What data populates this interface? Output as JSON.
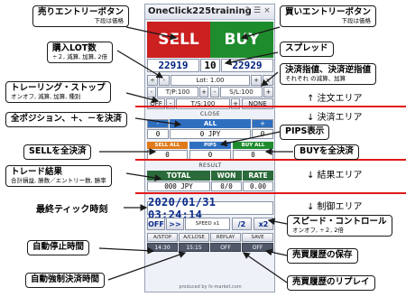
{
  "window": {
    "title": "OneClick225training",
    "icons": [
      "help-icon",
      "pin-icon",
      "close-icon"
    ],
    "help_glyph": "?",
    "pin_glyph": "☰",
    "close_glyph": "×"
  },
  "trade": {
    "sell_label": "SELL",
    "buy_label": "BUY",
    "sell_price": "22919",
    "spread": "10",
    "buy_price": "22929"
  },
  "lot": {
    "minus_label": "-",
    "value_label": "Lot: 1.00",
    "plus_label": "+",
    "half_label": "÷",
    "double_label": "x"
  },
  "tpsl": {
    "tp_label": "T/P:100",
    "sl_label": "S/L:100",
    "tp_minus": "-",
    "tp_plus": "+",
    "sl_minus": "-",
    "sl_plus": "+"
  },
  "trail": {
    "off_label": "OFF",
    "ts_label": "T/S:100",
    "minus": "-",
    "plus": "+",
    "none_label": "NONE"
  },
  "close": {
    "section_label": "CLOSE",
    "all_label": "ALL",
    "minus_label": "-",
    "plus_label": "+",
    "pos_left": "0",
    "pos_center": "0 JPY",
    "pos_right": "0",
    "sell_all_label": "SELL ALL",
    "pips_label": "PIPS",
    "buy_all_label": "BUY ALL",
    "sell_all_val": "0",
    "pips_val": "0",
    "buy_all_val": "0"
  },
  "result": {
    "section_label": "RESULT",
    "headers": [
      "TOTAL",
      "WON",
      "RATE"
    ],
    "values": [
      "000 JPY",
      "0/0",
      "0.00"
    ]
  },
  "control": {
    "clock": "2020/01/31 03:24:14",
    "off_label": "OFF",
    "ff_label": ">>",
    "speed_label": "SPEED x1",
    "half_label": "/2",
    "double_label": "x2",
    "autostop_label": "A/STOP",
    "aclose_label": "A/CLOSE",
    "replay_label": "REPLAY",
    "save_label": "SAVE",
    "autostop_time": "14:30",
    "aclose_time": "15:15",
    "replay_state": "OFF",
    "save_state": "OFF",
    "footer": "produced by fx-market.com"
  },
  "annotations": {
    "sell_entry": "売りエントリーボタン",
    "sell_entry_sub": "下段は価格",
    "buy_entry": "買いエントリーボタン",
    "buy_entry_sub": "下段は価格",
    "spread": "スプレッド",
    "lot": "購入LOT数",
    "lot_sub": "÷２, 減算, 加算, 2倍",
    "order_tpsl": "決済指値、決済逆指値",
    "order_tpsl_sub": "それぞれ の減算、加算",
    "trailing": "トレーリング・ストップ",
    "trailing_sub": "オンオフ, 減算, 加算, 種別",
    "order_area": "↑ 注文エリア",
    "all_close": "全ポジション、＋、－を決済",
    "close_area": "↓ 決済エリア",
    "pips_display": "PIPS表示",
    "sell_close": "SELLを全決済",
    "buy_close": "BUYを全決済",
    "result": "トレード結果",
    "result_sub": "合計損益, 勝数／エントリー数, 勝率",
    "result_area": "↓ 結果エリア",
    "last_tick": "最終ティック時刻",
    "control_area": "↓ 制御エリア",
    "speed_control": "スピード・コントロール",
    "speed_control_sub": "オンオフ, ÷２, 2倍",
    "auto_stop": "自動停止時間",
    "save_history": "売買履歴の保存",
    "auto_close": "自動強制決済時間",
    "replay": "売買履歴のリプレイ"
  },
  "colors": {
    "sell": "#cc1f1f",
    "buy": "#1e8c2d",
    "section_blue": "#2f6fc0",
    "section_orange": "#e07a1a",
    "result_green": "#2b6a3a",
    "divider_red": "#e01818"
  }
}
